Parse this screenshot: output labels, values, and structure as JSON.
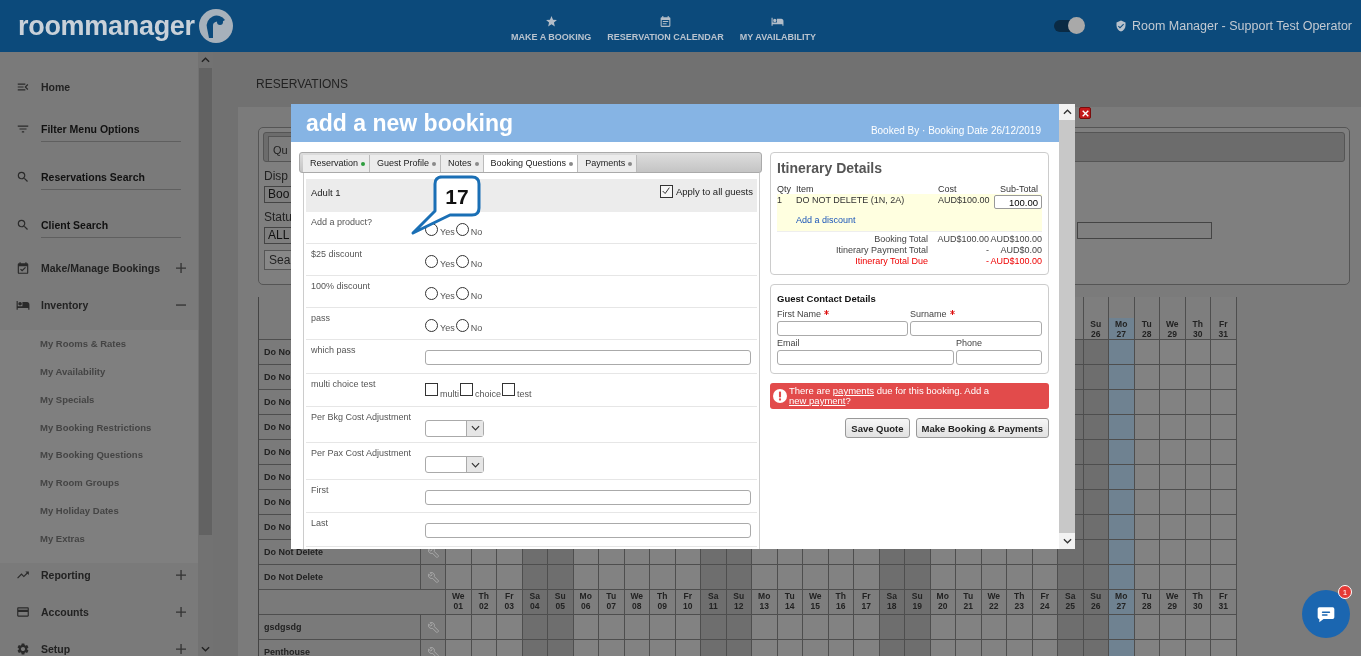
{
  "header": {
    "logo": "roommanager",
    "nav": [
      {
        "label": "MAKE A BOOKING"
      },
      {
        "label": "RESERVATION CALENDAR"
      },
      {
        "label": "MY AVAILABILITY"
      }
    ],
    "toggle": {
      "on": true
    },
    "user": "Room Manager - Support Test Operator"
  },
  "sidebar": {
    "items": [
      {
        "label": "Home",
        "kind": "link"
      },
      {
        "label": "Filter Menu Options",
        "kind": "underlined"
      },
      {
        "label": "Reservations Search",
        "kind": "underlined"
      },
      {
        "label": "Client Search",
        "kind": "underlined"
      },
      {
        "label": "Make/Manage Bookings",
        "kind": "group",
        "expanded": false
      },
      {
        "label": "Inventory",
        "kind": "group",
        "expanded": true,
        "children": [
          {
            "label": "My Rooms & Rates"
          },
          {
            "label": "My Availability"
          },
          {
            "label": "My Specials"
          },
          {
            "label": "My Booking Restrictions"
          },
          {
            "label": "My Booking Questions"
          },
          {
            "label": "My Room Groups"
          },
          {
            "label": "My Holiday Dates"
          },
          {
            "label": "My Extras"
          }
        ]
      },
      {
        "label": "Reporting",
        "kind": "group",
        "expanded": false
      },
      {
        "label": "Accounts",
        "kind": "group",
        "expanded": false
      },
      {
        "label": "Setup",
        "kind": "group",
        "expanded": false
      }
    ]
  },
  "page": {
    "title": "RESERVATIONS",
    "search_panel": {
      "tab": "Qu",
      "display_label": "Disp",
      "display_value": "Boo",
      "status_label": "Statu",
      "status_value": "ALL",
      "search_button": "Sea"
    }
  },
  "grid": {
    "top_header": [
      {
        "day": "Su",
        "date": "26",
        "today": false
      },
      {
        "day": "Mo",
        "date": "27",
        "today": true
      },
      {
        "day": "Tu",
        "date": "28",
        "today": false
      },
      {
        "day": "We",
        "date": "29",
        "today": false
      },
      {
        "day": "Th",
        "date": "30",
        "today": false
      },
      {
        "day": "Fr",
        "date": "31",
        "today": false
      }
    ],
    "rows_a": [
      {
        "label": "Do No"
      },
      {
        "label": "Do No"
      },
      {
        "label": "Do No"
      },
      {
        "label": "Do No"
      },
      {
        "label": "Do No"
      },
      {
        "label": "Do No"
      },
      {
        "label": "Do No"
      },
      {
        "label": "Do No"
      },
      {
        "label": "Do Not Delete",
        "tool": true
      },
      {
        "label": "Do Not Delete",
        "tool": true
      }
    ],
    "bottom_header": [
      {
        "day": "We",
        "date": "01",
        "weekend": false,
        "today": false
      },
      {
        "day": "Th",
        "date": "02",
        "weekend": false,
        "today": false
      },
      {
        "day": "Fr",
        "date": "03",
        "weekend": false,
        "today": false
      },
      {
        "day": "Sa",
        "date": "04",
        "weekend": true,
        "today": false
      },
      {
        "day": "Su",
        "date": "05",
        "weekend": true,
        "today": false
      },
      {
        "day": "Mo",
        "date": "06",
        "weekend": false,
        "today": false
      },
      {
        "day": "Tu",
        "date": "07",
        "weekend": false,
        "today": false
      },
      {
        "day": "We",
        "date": "08",
        "weekend": false,
        "today": false
      },
      {
        "day": "Th",
        "date": "09",
        "weekend": false,
        "today": false
      },
      {
        "day": "Fr",
        "date": "10",
        "weekend": false,
        "today": false
      },
      {
        "day": "Sa",
        "date": "11",
        "weekend": true,
        "today": false
      },
      {
        "day": "Su",
        "date": "12",
        "weekend": true,
        "today": false
      },
      {
        "day": "Mo",
        "date": "13",
        "weekend": false,
        "today": false
      },
      {
        "day": "Tu",
        "date": "14",
        "weekend": false,
        "today": false
      },
      {
        "day": "We",
        "date": "15",
        "weekend": false,
        "today": false
      },
      {
        "day": "Th",
        "date": "16",
        "weekend": false,
        "today": false
      },
      {
        "day": "Fr",
        "date": "17",
        "weekend": false,
        "today": false
      },
      {
        "day": "Sa",
        "date": "18",
        "weekend": true,
        "today": false
      },
      {
        "day": "Su",
        "date": "19",
        "weekend": true,
        "today": false
      },
      {
        "day": "Mo",
        "date": "20",
        "weekend": false,
        "today": false
      },
      {
        "day": "Tu",
        "date": "21",
        "weekend": false,
        "today": false
      },
      {
        "day": "We",
        "date": "22",
        "weekend": false,
        "today": false
      },
      {
        "day": "Th",
        "date": "23",
        "weekend": false,
        "today": false
      },
      {
        "day": "Fr",
        "date": "24",
        "weekend": false,
        "today": false
      },
      {
        "day": "Sa",
        "date": "25",
        "weekend": true,
        "today": false
      },
      {
        "day": "Su",
        "date": "26",
        "weekend": true,
        "today": false
      },
      {
        "day": "Mo",
        "date": "27",
        "weekend": false,
        "today": true
      },
      {
        "day": "Tu",
        "date": "28",
        "weekend": false,
        "today": false
      },
      {
        "day": "We",
        "date": "29",
        "weekend": false,
        "today": false
      },
      {
        "day": "Th",
        "date": "30",
        "weekend": false,
        "today": false
      },
      {
        "day": "Fr",
        "date": "31",
        "weekend": false,
        "today": false
      }
    ],
    "rows_b": [
      {
        "label": "gsdgsdg",
        "tool": true
      },
      {
        "label": "Penthouse",
        "tool": true
      }
    ]
  },
  "modal": {
    "title": "add a new booking",
    "subtitle": "Booked By · Booking Date 26/12/2019",
    "callout": "17",
    "tabs": [
      {
        "label": "Reservation",
        "selected": false,
        "color": "#2e9e3e"
      },
      {
        "label": "Guest Profile",
        "selected": false,
        "color": "#8a8a8a"
      },
      {
        "label": "Notes",
        "selected": false,
        "color": "#8a8a8a"
      },
      {
        "label": "Booking Questions",
        "selected": true,
        "color": "#8a8a8a"
      },
      {
        "label": "Payments",
        "selected": false,
        "color": "#8a8a8a"
      }
    ],
    "guest": "Adult 1",
    "apply_all": {
      "label": "Apply to all guests",
      "checked": true
    },
    "questions": [
      {
        "kind": "radio",
        "label": "Add a product?",
        "options": [
          {
            "label": "Yes",
            "selected": false
          },
          {
            "label": "No",
            "selected": false
          }
        ]
      },
      {
        "kind": "radio",
        "label": "$25 discount",
        "options": [
          {
            "label": "Yes",
            "selected": false
          },
          {
            "label": "No",
            "selected": false
          }
        ]
      },
      {
        "kind": "radio",
        "label": "100% discount",
        "options": [
          {
            "label": "Yes",
            "selected": false
          },
          {
            "label": "No",
            "selected": false
          }
        ]
      },
      {
        "kind": "radio",
        "label": "pass",
        "options": [
          {
            "label": "Yes",
            "selected": false
          },
          {
            "label": "No",
            "selected": false
          }
        ]
      },
      {
        "kind": "text",
        "label": "which pass"
      },
      {
        "kind": "checkbox",
        "label": "multi choice test",
        "options": [
          {
            "label": "multi",
            "checked": false
          },
          {
            "label": "choice",
            "checked": false
          },
          {
            "label": "test",
            "checked": false
          }
        ]
      },
      {
        "kind": "select",
        "label": "Per Bkg Cost Adjustment"
      },
      {
        "kind": "select",
        "label": "Per Pax Cost Adjustment"
      },
      {
        "kind": "text",
        "label": "First"
      },
      {
        "kind": "text",
        "label": "Last"
      }
    ],
    "itinerary": {
      "title": "Itinerary Details",
      "columns": [
        "Qty",
        "Item",
        "Cost",
        "Sub-Total"
      ],
      "line": {
        "qty": "1",
        "item": "DO NOT DELETE (1N, 2A)",
        "cost": "AUD$100.00",
        "subtotal": "100.00"
      },
      "discount_link": "Add a discount",
      "totals": [
        {
          "label": "Booking Total",
          "cost": "AUD$100.00",
          "subtotal": "AUD$100.00",
          "kind": "normal"
        },
        {
          "label": "Itinerary Payment Total",
          "cost": "-",
          "subtotal": "AUD$0.00",
          "kind": "normal"
        },
        {
          "label": "Itinerary Total Due",
          "cost": "-",
          "subtotal": "AUD$100.00",
          "kind": "due"
        }
      ]
    },
    "contact": {
      "title": "Guest Contact Details",
      "fields": [
        {
          "label": "First Name",
          "required": true
        },
        {
          "label": "Surname",
          "required": true
        },
        {
          "label": "Email",
          "required": false
        },
        {
          "label": "Phone",
          "required": false
        }
      ]
    },
    "alert": {
      "parts": [
        {
          "text": "There are ",
          "kind": "text"
        },
        {
          "text": "payments",
          "kind": "link"
        },
        {
          "text": " due for this booking. Add a ",
          "kind": "text"
        },
        {
          "text": "new payment",
          "kind": "link"
        },
        {
          "text": "?",
          "kind": "text"
        }
      ]
    },
    "buttons": [
      "Save Quote",
      "Make Booking & Payments"
    ]
  },
  "chat": {
    "badge": "1"
  }
}
